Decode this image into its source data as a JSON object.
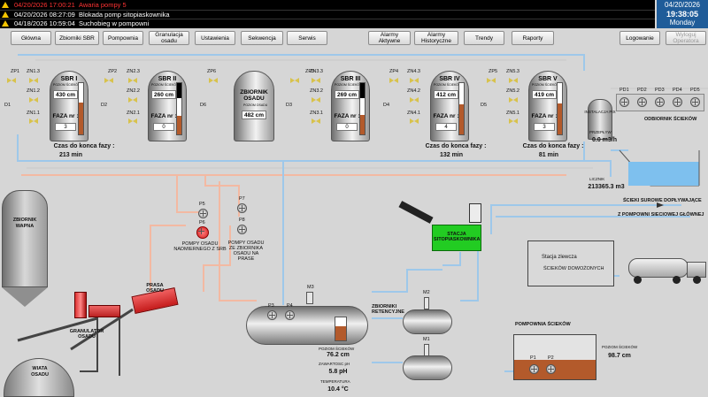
{
  "alarms": [
    {
      "time": "04/20/2026 17:00:21",
      "message": "Awaria pompy 5",
      "color": "#ff3333"
    },
    {
      "time": "04/20/2026 08:27:09",
      "message": "Blokada pomp sitopiaskownika",
      "color": "#ffffff"
    },
    {
      "time": "04/18/2026 10:59:04",
      "message": "Suchobieg w pompowni",
      "color": "#ffffff"
    }
  ],
  "datetime": {
    "date": "04/20/2026",
    "time": "19:38:05",
    "day": "Monday"
  },
  "nav": [
    "Główna",
    "Zbiorniki SBR",
    "Pompownia",
    "Granulacja osadu",
    "Ustawienia",
    "Sekwencja",
    "Serwis",
    "Alarmy Aktywne",
    "Alarmy Historyczne",
    "Trendy",
    "Raporty",
    "Logowanie",
    "Wyloguj Operatora"
  ],
  "tanks": [
    {
      "name": "SBR I",
      "sub": "POZIOM ŚCIEKÓW",
      "level": "430 cm",
      "faza_label": "FAZA nr :",
      "faza": "3",
      "fill": 0.62
    },
    {
      "name": "SBR II",
      "sub": "POZIOM ŚCIEKÓW",
      "level": "260 cm",
      "faza_label": "FAZA nr :",
      "faza": "0",
      "fill": 0.37
    },
    {
      "name": "ZBIORNIK OSADU",
      "sub": "POZIOM OSADU",
      "level": "482 cm",
      "faza_label": "",
      "faza": "",
      "fill": 0.0
    },
    {
      "name": "SBR III",
      "sub": "POZIOM ŚCIEKÓW",
      "level": "269 cm",
      "faza_label": "FAZA nr :",
      "faza": "0",
      "fill": 0.38
    },
    {
      "name": "SBR IV",
      "sub": "POZIOM ŚCIEKÓW",
      "level": "412 cm",
      "faza_label": "FAZA nr :",
      "faza": "4",
      "fill": 0.59
    },
    {
      "name": "SBR V",
      "sub": "POZIOM ŚCIEKÓW",
      "level": "419 cm",
      "faza_label": "FAZA nr :",
      "faza": "3",
      "fill": 0.6
    }
  ],
  "czas": [
    {
      "label": "Czas do konca fazy :",
      "value": "213 min"
    },
    {
      "label": "Czas do konca fazy :",
      "value": "132 min"
    },
    {
      "label": "Czas do konca fazy :",
      "value": "81 min"
    }
  ],
  "labels": {
    "zp1": "ZP1",
    "zp2": "ZP2",
    "zp6": "ZP6",
    "zp3": "ZP3",
    "zp4": "ZP4",
    "zp5": "ZP5",
    "zn13": "ZN1.3",
    "zn12": "ZN1.2",
    "zn11": "ZN1.1",
    "zn23": "ZN2.3",
    "zn22": "ZN2.2",
    "zn21": "ZN2.1",
    "zn33": "ZN3.3",
    "zn32": "ZN3.2",
    "zn31": "ZN3.1",
    "zn43": "ZN4.3",
    "zn42": "ZN4.2",
    "zn41": "ZN4.1",
    "zn53": "ZN5.3",
    "zn52": "ZN5.2",
    "zn51": "ZN5.1",
    "d1": "D1",
    "d2": "D2",
    "d6": "D6",
    "d3": "D3",
    "d4": "D4",
    "d5": "D5",
    "pd": [
      "PD1",
      "PD2",
      "PD3",
      "PD4",
      "PD5"
    ],
    "instalacja": "INSTALACJA PIX",
    "odbiornik": "ODBIORNIK ŚCIEKÓW",
    "przeplyw": "PRZEPŁYW",
    "przeplyw_val": "0.0 m3/h",
    "licznik": "LICZNIK",
    "licznik_val": "213365.3 m3",
    "scieki_surowe": "ŚCIEKI SUROWE DOPŁYWAJĄCE",
    "z_pompowni": "Z POMPOWNI SIECIOWEJ GŁÓWNEJ",
    "zbiornik_wapna": "ZBIORNIK WAPNA",
    "prasa": "PRASA OSADU",
    "granulator": "GRANULATOR OSADU",
    "wiata": "WIATA OSADU",
    "p5": "P5",
    "p6": "P6",
    "p7": "P7",
    "p8": "P8",
    "pompy_nadmiernego": "POMPY OSADU NADMIERNEGO Z SRB",
    "pompy_zbiornika": "POMPY OSADU ZE ZBIORNIKA OSADU NA PRASE",
    "stacja_sito": "STACJA SITOPIASKOWNIKA",
    "stacja_zlewcza": "Stacja zlewcza",
    "sciekow_dowoz": "ŚCIEKÓW DOWOŻONYCH",
    "zbiorniki_ret": "ZBIORNIKI RETENCYJNE",
    "p3": "P3",
    "p4": "P4",
    "m3": "M3",
    "m2": "M2",
    "m1": "M1",
    "poziom_sciekow": "POZIOM ŚCIEKÓW",
    "ret_level": "76.2 cm",
    "odczyn": "ZAWARTOSC pH",
    "ph_val": "5.8 pH",
    "temp": "TEMPERATURA",
    "temp_val": "10.4 °C",
    "pompownia": "POMPOWNIA ŚCIEKÓW",
    "poziom_sciekow2": "POZIOM ŚCIEKÓW",
    "pomp_level": "98.7 cm",
    "p1": "P1",
    "p2": "P2"
  },
  "colors": {
    "alarm_red": "#ff3333",
    "pipe_blue": "#9ec8ea",
    "pipe_sludge": "#f3b9a2",
    "sludge": "#b35a2b",
    "water": "#7ec0ee",
    "green_station": "#22cc22"
  }
}
